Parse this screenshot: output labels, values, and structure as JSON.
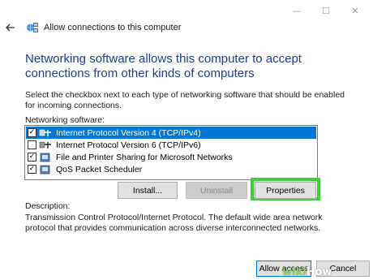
{
  "window": {
    "minimize_glyph": "—",
    "maximize_glyph": "☐",
    "close_glyph": "✕"
  },
  "titlebar": {
    "back_icon": "back-arrow-icon",
    "app_icon": "network-connections-icon",
    "title": "Allow connections to this computer"
  },
  "main": {
    "heading": "Networking software allows this computer to accept connections from other kinds of computers",
    "instruction": "Select the checkbox next to each type of networking software that should be enabled for incoming connections.",
    "list_label": "Networking software:",
    "items": [
      {
        "label": "Internet Protocol Version 4 (TCP/IPv4)",
        "checked": "✓",
        "icon": "protocol-icon",
        "selected": true
      },
      {
        "label": "Internet Protocol Version 6 (TCP/IPv6)",
        "checked": "",
        "icon": "protocol-icon",
        "selected": false
      },
      {
        "label": "File and Printer Sharing for Microsoft Networks",
        "checked": "✓",
        "icon": "service-icon",
        "selected": false
      },
      {
        "label": "QoS Packet Scheduler",
        "checked": "✓",
        "icon": "service-icon",
        "selected": false
      }
    ],
    "buttons": {
      "install": "Install...",
      "uninstall": "Uninstall",
      "properties": "Properties"
    },
    "description_label": "Description:",
    "description": "Transmission Control Protocol/Internet Protocol. The default wide area network protocol that provides communication across diverse interconnected networks."
  },
  "footer": {
    "allow_access": "Allow access",
    "cancel": "Cancel"
  },
  "watermark": {
    "part1": "wiki",
    "part2": "How"
  },
  "colors": {
    "heading": "#1e3c8c",
    "selection": "#0078d7",
    "highlight": "#3ad23a"
  }
}
